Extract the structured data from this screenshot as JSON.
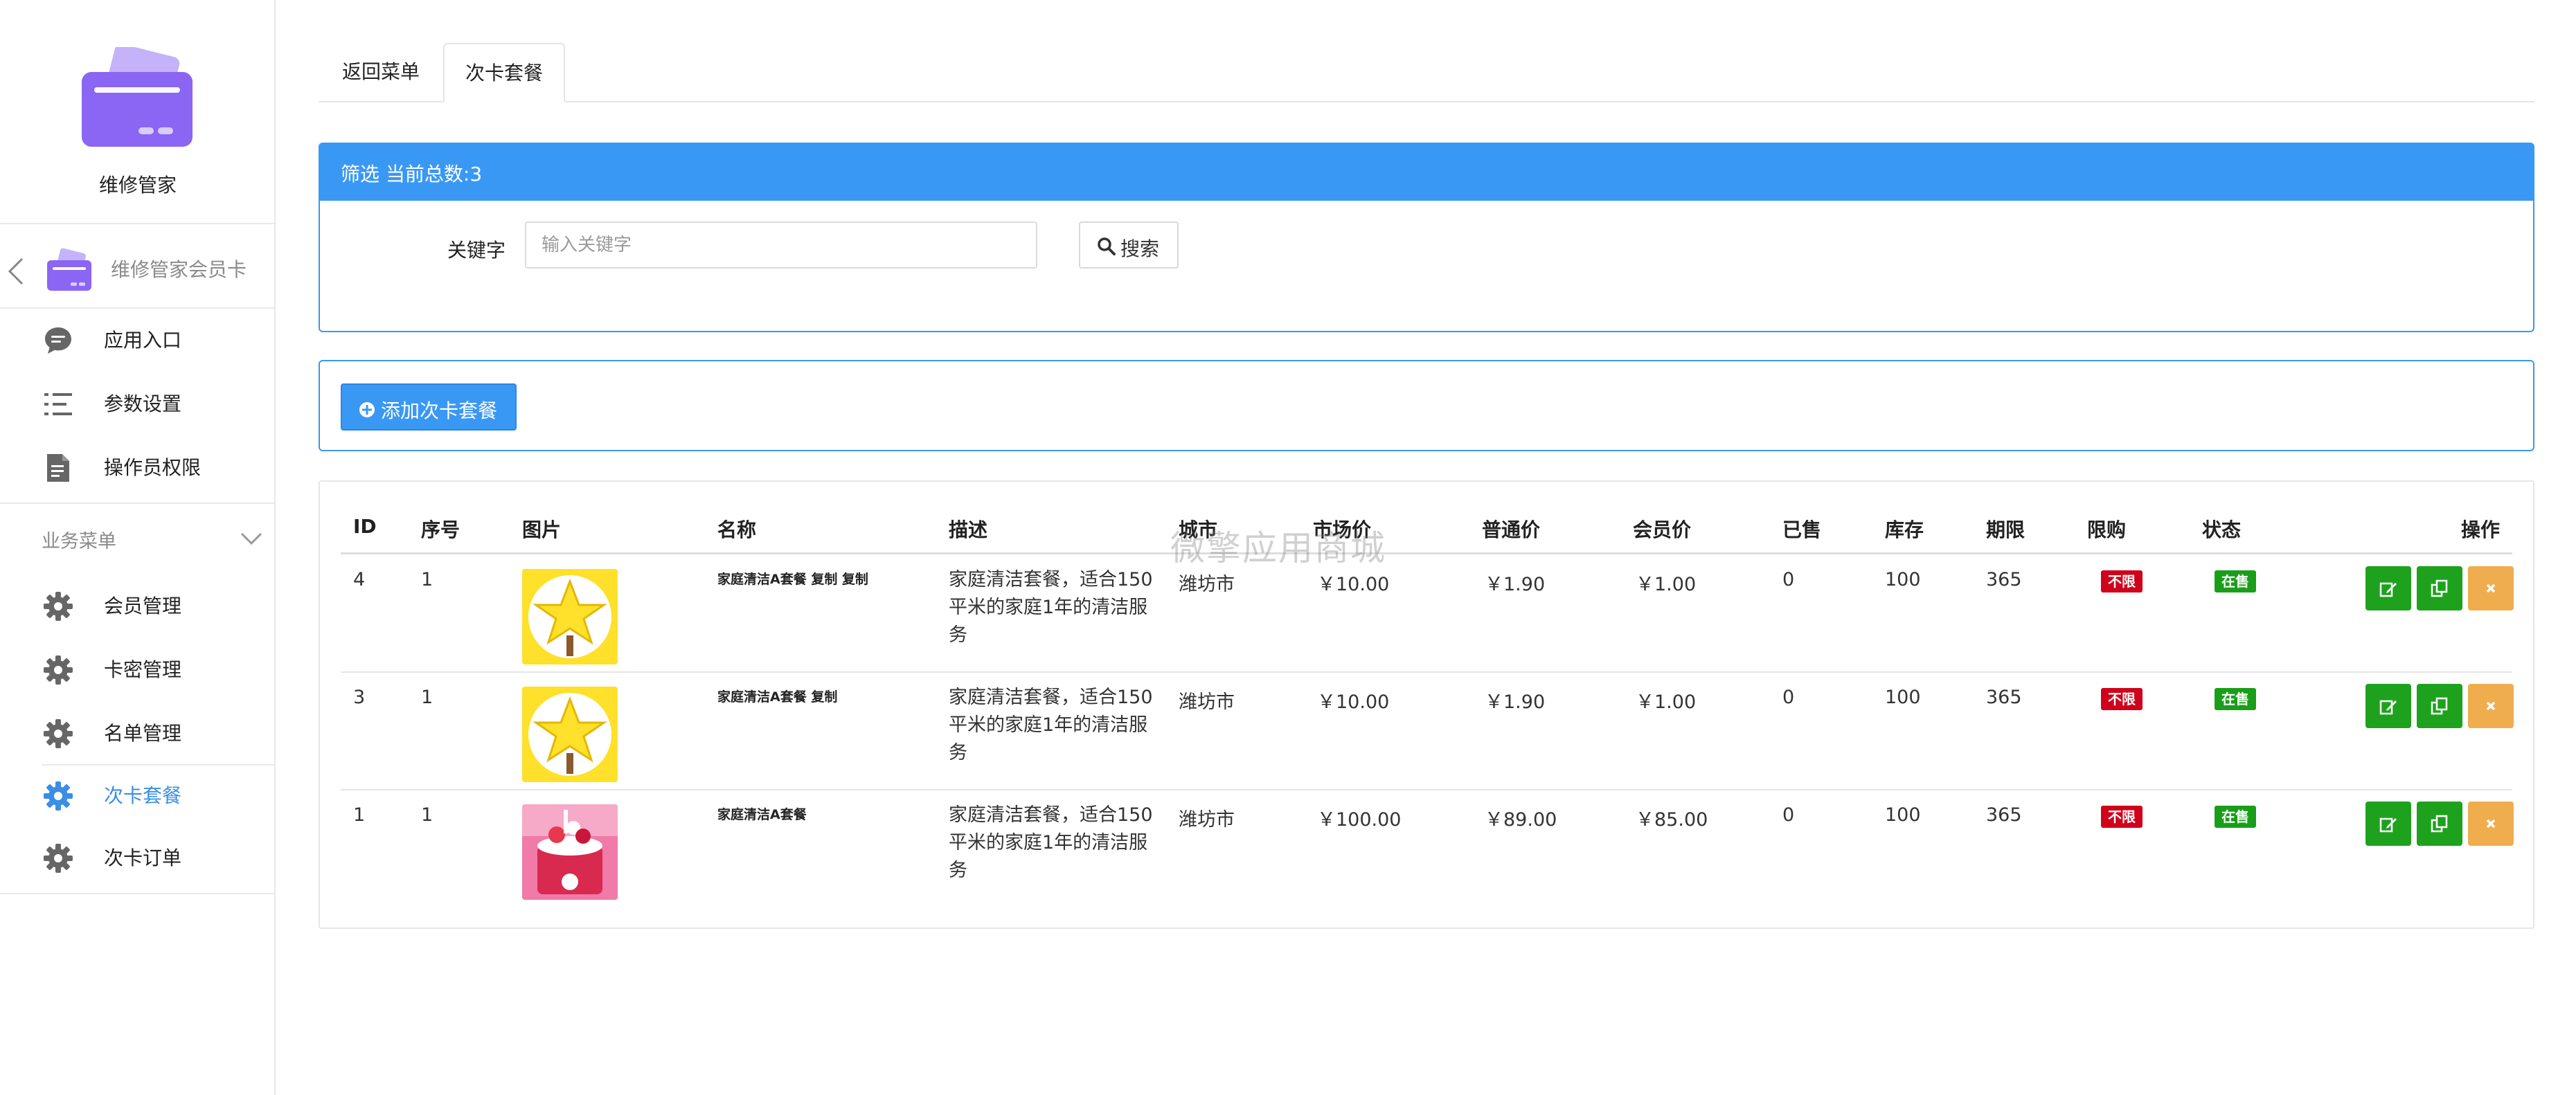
{
  "app": {
    "name": "维修管家",
    "logo_colors": [
      "#a98ff5",
      "#7b57f0"
    ]
  },
  "sidebar": {
    "back_item": {
      "label": "维修管家会员卡",
      "icon": "chevron-left-icon"
    },
    "top_items": [
      {
        "label": "应用入口",
        "icon": "chat-bubble-icon"
      },
      {
        "label": "参数设置",
        "icon": "list-settings-icon"
      },
      {
        "label": "操作员权限",
        "icon": "document-icon"
      }
    ],
    "section": {
      "label": "业务菜单",
      "icon": "chevron-down-icon"
    },
    "section_items": [
      {
        "label": "会员管理",
        "icon": "gear-icon",
        "active": false
      },
      {
        "label": "卡密管理",
        "icon": "gear-icon",
        "active": false
      },
      {
        "label": "名单管理",
        "icon": "gear-icon",
        "active": false
      },
      {
        "label": "次卡套餐",
        "icon": "gear-icon",
        "active": true
      },
      {
        "label": "次卡订单",
        "icon": "gear-icon",
        "active": false
      }
    ],
    "active_color": "#3a8ee6"
  },
  "tabs": [
    {
      "label": "返回菜单",
      "active": false
    },
    {
      "label": "次卡套餐",
      "active": true
    }
  ],
  "filter": {
    "title": "筛选 当前总数:3",
    "keyword_label": "关键字",
    "keyword_value": "",
    "keyword_placeholder": "输入关键字",
    "search_label": "搜索",
    "search_icon": "search-icon",
    "header_color": "#3a98f5"
  },
  "add_button": {
    "label": "添加次卡套餐",
    "icon": "plus-circle-icon"
  },
  "table": {
    "columns": {
      "id": "ID",
      "seq": "序号",
      "image": "图片",
      "name": "名称",
      "desc": "描述",
      "city": "城市",
      "market_price": "市场价",
      "normal_price": "普通价",
      "member_price": "会员价",
      "sold": "已售",
      "stock": "库存",
      "period": "期限",
      "limit": "限购",
      "status": "状态",
      "ops": "操作"
    },
    "rows": [
      {
        "id": "4",
        "seq": "1",
        "image": "star-image",
        "name": "家庭清洁A套餐 复制 复制",
        "desc": "家庭清洁套餐，适合150平米的家庭1年的清洁服务",
        "city": "潍坊市",
        "market_price": "￥10.00",
        "normal_price": "￥1.90",
        "member_price": "￥1.00",
        "sold": "0",
        "stock": "100",
        "period": "365",
        "limit": "不限",
        "status": "在售"
      },
      {
        "id": "3",
        "seq": "1",
        "image": "star-image",
        "name": "家庭清洁A套餐 复制",
        "desc": "家庭清洁套餐，适合150平米的家庭1年的清洁服务",
        "city": "潍坊市",
        "market_price": "￥10.00",
        "normal_price": "￥1.90",
        "member_price": "￥1.00",
        "sold": "0",
        "stock": "100",
        "period": "365",
        "limit": "不限",
        "status": "在售"
      },
      {
        "id": "1",
        "seq": "1",
        "image": "cake-image",
        "name": "家庭清洁A套餐",
        "desc": "家庭清洁套餐，适合150平米的家庭1年的清洁服务",
        "city": "潍坊市",
        "market_price": "￥100.00",
        "normal_price": "￥89.00",
        "member_price": "￥85.00",
        "sold": "0",
        "stock": "100",
        "period": "365",
        "limit": "不限",
        "status": "在售"
      }
    ],
    "op_icons": [
      "edit-icon",
      "copy-icon",
      "close-icon"
    ],
    "colors": {
      "limit": "#d0021b",
      "status": "#1a9e1a",
      "edit": "#1ea21e",
      "delete": "#f0ad4e"
    }
  },
  "watermark": "微擎应用商城"
}
